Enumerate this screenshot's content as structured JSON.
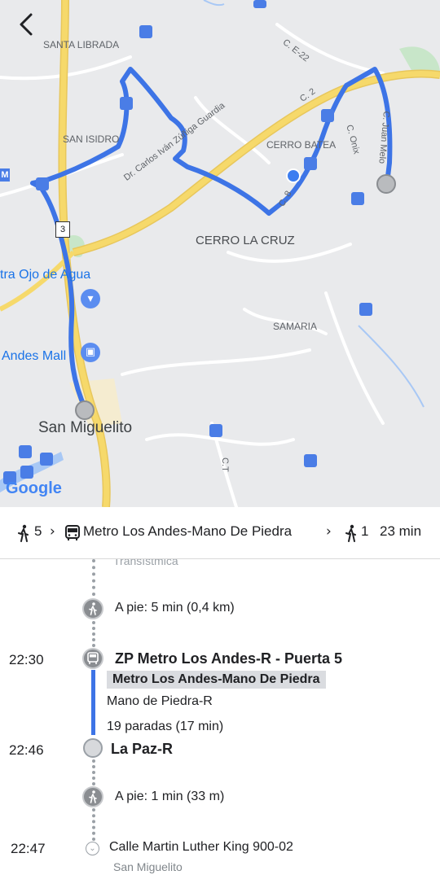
{
  "map": {
    "labels": {
      "santa_librada": "SANTA LIBRADA",
      "san_isidro": "SAN ISIDRO",
      "cerro_batea": "CERRO BATEA",
      "cerro_la_cruz": "CERRO LA CRUZ",
      "samaria": "SAMARIA",
      "road_carlos": "Dr. Carlos Iván Zúñiga Guardia",
      "c_e22": "C. E-22",
      "c2": "C. 2",
      "c_onix": "C. Onix",
      "c_juan": "C. Juan Melo",
      "c8": "C. 8",
      "ct": "C.T",
      "route_3": "3",
      "ojo_de_agua": "tra Ojo de Agua",
      "andes_mall": "Andes Mall",
      "san_miguelito": "San Miguelito",
      "m_badge": "M",
      "google_logo": "Google"
    },
    "colors": {
      "route": "#3d74e6",
      "highway": "#f6d96b",
      "park": "#c8e6c9",
      "water": "#a8c8f5",
      "bus_stop": "#4a7de6",
      "place_pin": "#5b8df0"
    }
  },
  "summary": {
    "walk_start": "5",
    "bus_line": "Metro Los Andes-Mano De Piedra",
    "walk_end": "1",
    "duration": "23 min"
  },
  "timeline": {
    "prev_label": "Transístmica",
    "walk1": "A pie: 5 min (0,4 km)",
    "board_time": "22:30",
    "board_stop": "ZP Metro Los Andes-R - Puerta 5",
    "route_name": "Metro Los Andes-Mano De Piedra",
    "headsign": "Mano de Piedra-R",
    "stops_info": "19 paradas (17 min)",
    "alight_time": "22:46",
    "alight_stop": "La Paz-R",
    "walk2": "A pie: 1 min (33 m)",
    "dest_time": "22:47",
    "dest_address": "Calle Martin Luther King 900-02",
    "dest_city": "San Miguelito"
  }
}
